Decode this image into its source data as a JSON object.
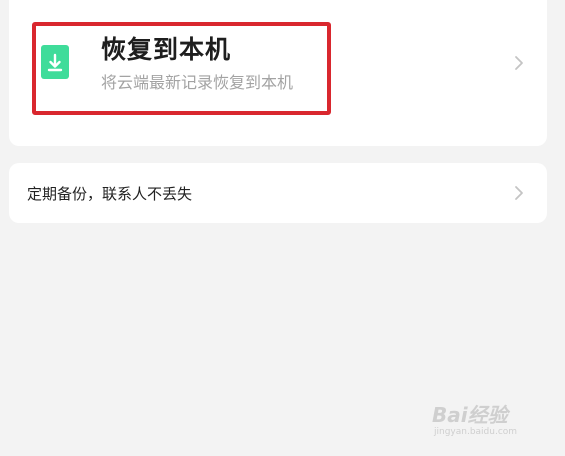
{
  "restore": {
    "title": "恢复到本机",
    "subtitle": "将云端最新记录恢复到本机",
    "icon": "download-icon",
    "icon_color": "#3fdc9a",
    "highlight_color": "#d9272e"
  },
  "backup": {
    "label": "定期备份，联系人不丢失"
  },
  "watermark": {
    "brand": "Bai经验",
    "url": "jingyan.baidu.com"
  }
}
